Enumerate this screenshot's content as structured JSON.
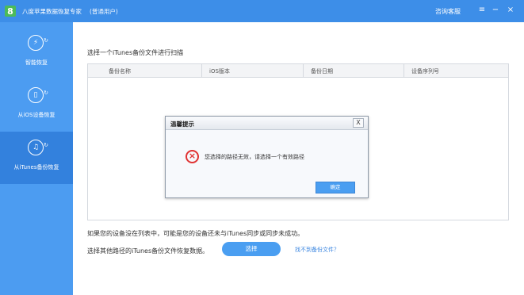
{
  "titlebar": {
    "logo": "8",
    "app_title": "八度苹果数据恢复专家",
    "user_type": "(普通用户)",
    "consult": "咨询客服",
    "menu_icon": "menu-icon",
    "min_icon": "minimize-icon",
    "close_icon": "close-icon"
  },
  "sidebar": {
    "items": [
      {
        "label": "智能恢复",
        "icon": "smart-recover-icon"
      },
      {
        "label": "从iOS设备恢复",
        "icon": "ios-device-icon"
      },
      {
        "label": "从iTunes备份恢复",
        "icon": "itunes-backup-icon",
        "active": true
      }
    ]
  },
  "main": {
    "section_title": "选择一个iTunes备份文件进行扫描",
    "table": {
      "columns": [
        "备份名称",
        "iOS版本",
        "备份日期",
        "设备序列号"
      ],
      "rows": []
    },
    "hint_line1": "如果您的设备没在列表中，可能是您的设备还未与iTunes同步或同步未成功。",
    "hint_line2": "选择其他路径的iTunes备份文件恢复数据。",
    "choose_button": "选择",
    "link_text": "找不到备份文件？"
  },
  "dialog": {
    "title": "温馨提示",
    "close": "X",
    "message": "您选择的路径无效，请选择一个有效路径",
    "ok_button": "确定"
  },
  "colors": {
    "titlebar": "#3d8ee8",
    "sidebar": "#4c9cf1",
    "sidebar_active": "#3381dd",
    "accent": "#4a9ef1",
    "error": "#e03333",
    "link": "#3b86e0"
  }
}
